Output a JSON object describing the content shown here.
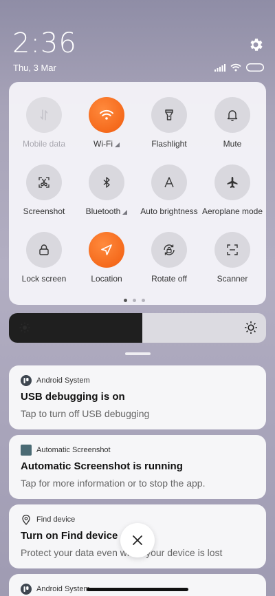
{
  "status": {
    "time": "2:36",
    "date": "Thu, 3 Mar",
    "icons": [
      "signal-icon",
      "wifi-icon",
      "battery-icon"
    ],
    "settings_icon": "gear-icon"
  },
  "quick_settings": {
    "tiles": [
      {
        "label": "Mobile data",
        "icon": "mobile-data-icon",
        "state": "disabled"
      },
      {
        "label": "Wi-Fi",
        "icon": "wifi-icon",
        "state": "on",
        "expandable": true
      },
      {
        "label": "Flashlight",
        "icon": "flashlight-icon",
        "state": "off"
      },
      {
        "label": "Mute",
        "icon": "bell-icon",
        "state": "off"
      },
      {
        "label": "Screenshot",
        "icon": "scissors-icon",
        "state": "off"
      },
      {
        "label": "Bluetooth",
        "icon": "bluetooth-icon",
        "state": "off",
        "expandable": true
      },
      {
        "label": "Auto brightness",
        "icon": "auto-brightness-icon",
        "state": "off"
      },
      {
        "label": "Aeroplane mode",
        "icon": "airplane-icon",
        "state": "off"
      },
      {
        "label": "Lock screen",
        "icon": "lock-icon",
        "state": "off"
      },
      {
        "label": "Location",
        "icon": "location-icon",
        "state": "on"
      },
      {
        "label": "Rotate off",
        "icon": "rotate-lock-icon",
        "state": "off"
      },
      {
        "label": "Scanner",
        "icon": "scanner-icon",
        "state": "off"
      }
    ],
    "page_count": 3,
    "current_page": 1,
    "accent_color": "#f56a1c"
  },
  "brightness": {
    "level": 0.52
  },
  "notifications": [
    {
      "app": "Android System",
      "title": "USB debugging is on",
      "text": "Tap to turn off USB debugging",
      "icon": "android-system-icon"
    },
    {
      "app": "Automatic Screenshot",
      "title": "Automatic Screenshot is running",
      "text": "Tap for more information or to stop the app.",
      "icon": "screenshot-app-icon"
    },
    {
      "app": "Find device",
      "title": "Turn on Find device",
      "text": "Protect your data even when your device is lost",
      "icon": "find-device-icon"
    },
    {
      "app": "Android System",
      "title": "",
      "text": "",
      "icon": "android-system-icon"
    }
  ],
  "dismiss_icon": "close-icon"
}
